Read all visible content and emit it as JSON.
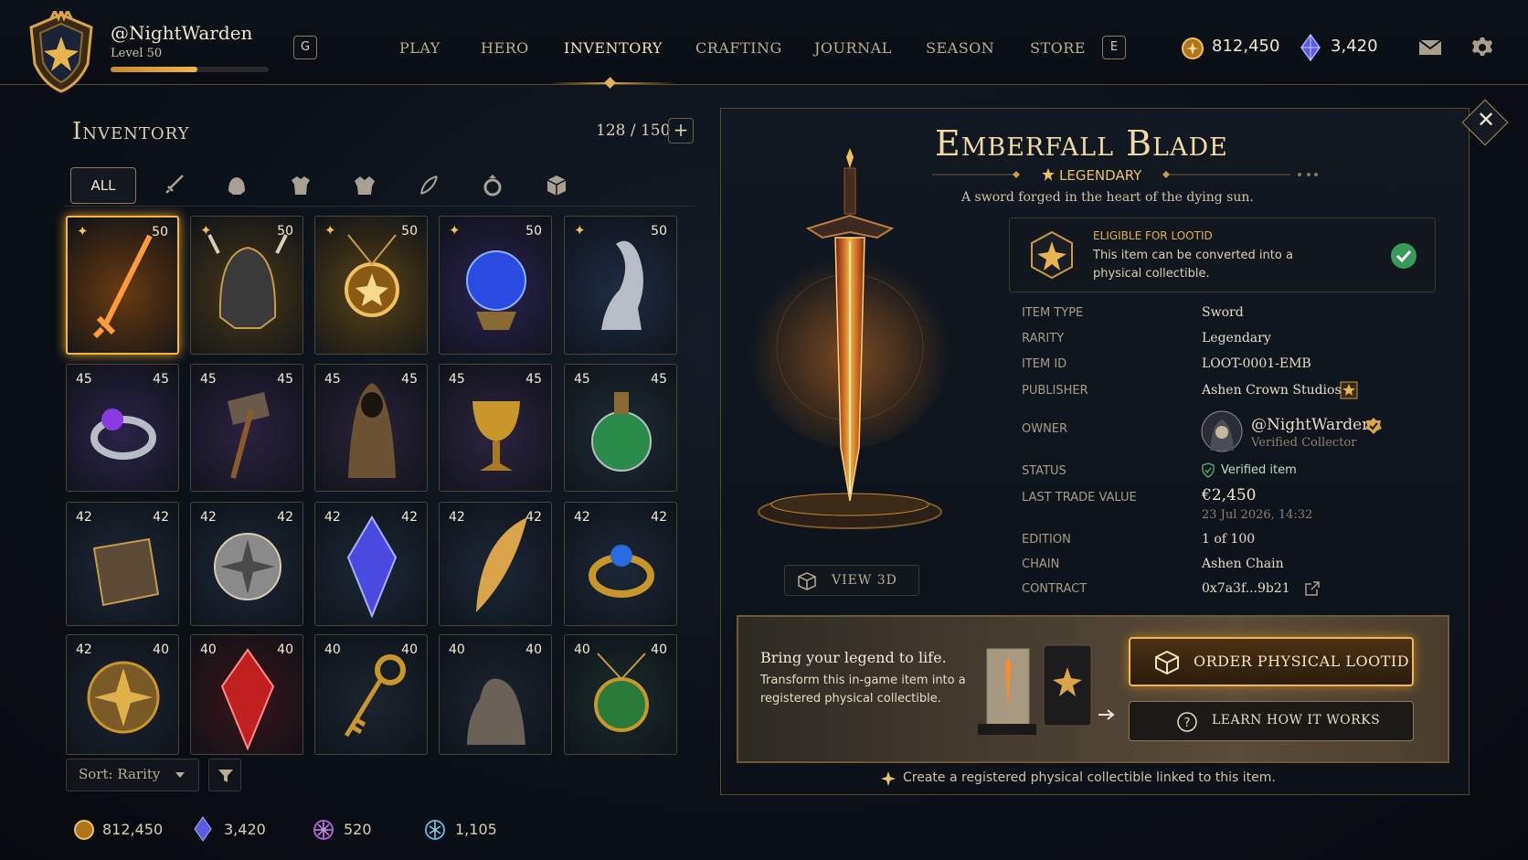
{
  "player": {
    "name": "@NightWarden",
    "level": "Level 50",
    "xp_fraction": 0.55
  },
  "topbar": {
    "key_left": "G",
    "key_right": "E",
    "nav": [
      "PLAY",
      "HERO",
      "INVENTORY",
      "CRAFTING",
      "JOURNAL",
      "SEASON",
      "STORE"
    ],
    "active_nav": "INVENTORY",
    "gold": "812,450",
    "gems": "3,420",
    "icons": [
      "coin-icon",
      "gem-icon",
      "mail-icon",
      "gear-icon"
    ]
  },
  "inventory": {
    "title": "Inventory",
    "count": "128 / 150",
    "add_label": "+",
    "filter_all": "ALL",
    "filter_icons": [
      "sword-icon",
      "helmet-icon",
      "armor-icon",
      "chest-armor-icon",
      "feather-icon",
      "ring-icon",
      "box-icon"
    ],
    "sort_label": "Sort: Rarity",
    "items": [
      {
        "name": "sword",
        "level": "50",
        "left": "",
        "star": true,
        "bg": "#6a3a10",
        "selected": true
      },
      {
        "name": "helmet",
        "level": "50",
        "left": "",
        "star": true,
        "bg": "#4a3a1a"
      },
      {
        "name": "amulet",
        "level": "50",
        "left": "",
        "star": true,
        "bg": "#5a4418"
      },
      {
        "name": "orb",
        "level": "50",
        "left": "",
        "star": true,
        "bg": "#2a2350"
      },
      {
        "name": "dragon-statue",
        "level": "50",
        "left": "",
        "star": true,
        "bg": "#1e2c44"
      },
      {
        "name": "ring-purple",
        "level": "45",
        "left": "45",
        "bg": "#2c2448"
      },
      {
        "name": "hammer",
        "level": "45",
        "left": "45",
        "bg": "#2c2240"
      },
      {
        "name": "cloak",
        "level": "45",
        "left": "45",
        "bg": "#2a2238"
      },
      {
        "name": "chalice",
        "level": "45",
        "left": "45",
        "bg": "#2c2440"
      },
      {
        "name": "potion",
        "level": "45",
        "left": "45",
        "bg": "#1e2e34"
      },
      {
        "name": "tome",
        "level": "42",
        "left": "42",
        "bg": "#1c2838"
      },
      {
        "name": "shield",
        "level": "42",
        "left": "42",
        "bg": "#1c2838"
      },
      {
        "name": "crystal-blue",
        "level": "42",
        "left": "42",
        "bg": "#1c2838"
      },
      {
        "name": "quill",
        "level": "42",
        "left": "42",
        "bg": "#1c2838"
      },
      {
        "name": "ring-blue",
        "level": "42",
        "left": "42",
        "bg": "#1c2838"
      },
      {
        "name": "round-shield",
        "level": "40",
        "left": "42",
        "bg": "#1c2430"
      },
      {
        "name": "crystal-red",
        "level": "40",
        "left": "40",
        "bg": "#3a1418"
      },
      {
        "name": "key",
        "level": "40",
        "left": "40",
        "bg": "#1c2430"
      },
      {
        "name": "dragon-figure",
        "level": "40",
        "left": "40",
        "bg": "#1c2430"
      },
      {
        "name": "green-amulet",
        "level": "40",
        "left": "40",
        "bg": "#1a2c2c"
      }
    ]
  },
  "currencies": [
    {
      "icon": "gold-coin-icon",
      "value": "812,450",
      "color": "#e0a43a"
    },
    {
      "icon": "gem-icon",
      "value": "3,420",
      "color": "#6c78f0"
    },
    {
      "icon": "arcane-icon",
      "value": "520",
      "color": "#b05ae0"
    },
    {
      "icon": "rune-icon",
      "value": "1,105",
      "color": "#5ab0e0"
    }
  ],
  "detail": {
    "name": "Emberfall Blade",
    "rarity": "LEGENDARY",
    "description": "A sword forged in the heart of the dying sun.",
    "eligible_title": "ELIGIBLE FOR LOOTID",
    "eligible_text": "This item can be converted into a physical collectible.",
    "view3d": "VIEW 3D",
    "props": [
      {
        "k": "ITEM TYPE",
        "v": "Sword"
      },
      {
        "k": "RARITY",
        "v": "Legendary"
      },
      {
        "k": "ITEM ID",
        "v": "LOOT-0001-EMB"
      },
      {
        "k": "PUBLISHER",
        "v": "Ashen Crown Studios"
      },
      {
        "k": "OWNER",
        "v": "@NightWarden"
      },
      {
        "k": "STATUS",
        "v": "Verified item"
      },
      {
        "k": "LAST TRADE VALUE",
        "v": "€2,450"
      },
      {
        "k": "EDITION",
        "v": "1 of 100"
      },
      {
        "k": "CHAIN",
        "v": "Ashen Chain"
      },
      {
        "k": "CONTRACT",
        "v": "0x7a3f...9b21"
      }
    ],
    "owner_sub": "Verified Collector",
    "trade_date": "23 Jul 2026, 14:32",
    "promo_heading": "Bring your legend to life.",
    "promo_text": "Transform this in-game item into a registered physical collectible.",
    "order_label": "ORDER PHYSICAL LOOTID",
    "learn_label": "LEARN HOW IT WORKS",
    "footnote": "Create a registered physical collectible linked to this item."
  },
  "colors": {
    "accent": "#e3b14f",
    "bg": "#0c1118",
    "verified": "#4aa86a"
  }
}
